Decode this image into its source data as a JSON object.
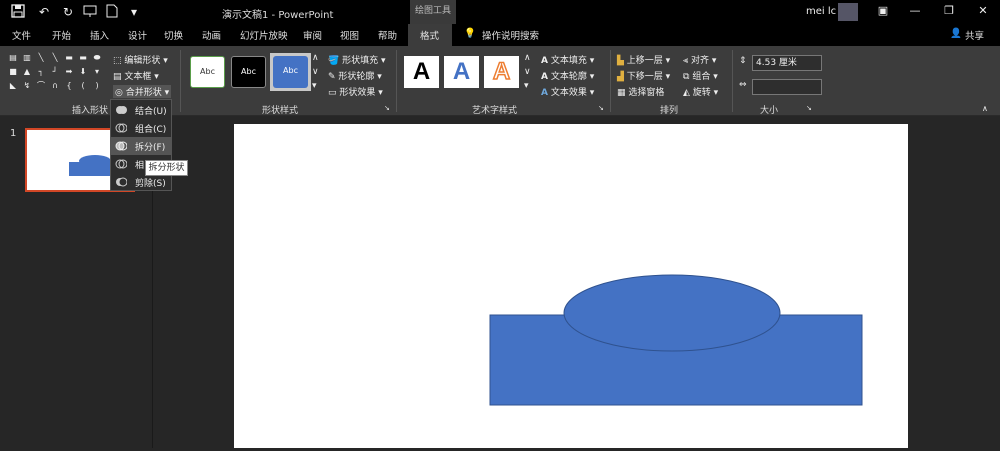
{
  "titlebar": {
    "doc_title": "演示文稿1 - PowerPoint",
    "context_tools": "绘图工具",
    "user": "mei lc"
  },
  "tabs": [
    "文件",
    "开始",
    "插入",
    "设计",
    "切换",
    "动画",
    "幻灯片放映",
    "审阅",
    "视图",
    "帮助",
    "格式"
  ],
  "search_label": "操作说明搜索",
  "share_label": "共享",
  "ribbon": {
    "insert_shapes": {
      "label": "插入形状",
      "edit_shape": "编辑形状",
      "text_box": "文本框",
      "merge_shapes": "合并形状"
    },
    "shape_styles": {
      "label": "形状样式",
      "thumb_text": "Abc",
      "fill": "形状填充",
      "outline": "形状轮廓",
      "effects": "形状效果"
    },
    "wordart": {
      "label": "艺术字样式",
      "letter": "A",
      "text_fill": "文本填充",
      "text_outline": "文本轮廓",
      "text_effects": "文本效果"
    },
    "arrange": {
      "label": "排列",
      "bring_forward": "上移一层",
      "send_backward": "下移一层",
      "selection_pane": "选择窗格",
      "align": "对齐",
      "group": "组合",
      "rotate": "旋转"
    },
    "size": {
      "label": "大小",
      "height": "4.53 厘米",
      "width": ""
    }
  },
  "merge_menu": {
    "items": [
      "结合(U)",
      "组合(C)",
      "拆分(F)",
      "相",
      "剪除(S)"
    ],
    "tooltip": "拆分形状"
  },
  "thumbnails": {
    "slide_number": "1"
  },
  "colors": {
    "shape_fill": "#4472c4",
    "accent": "#d24726"
  }
}
